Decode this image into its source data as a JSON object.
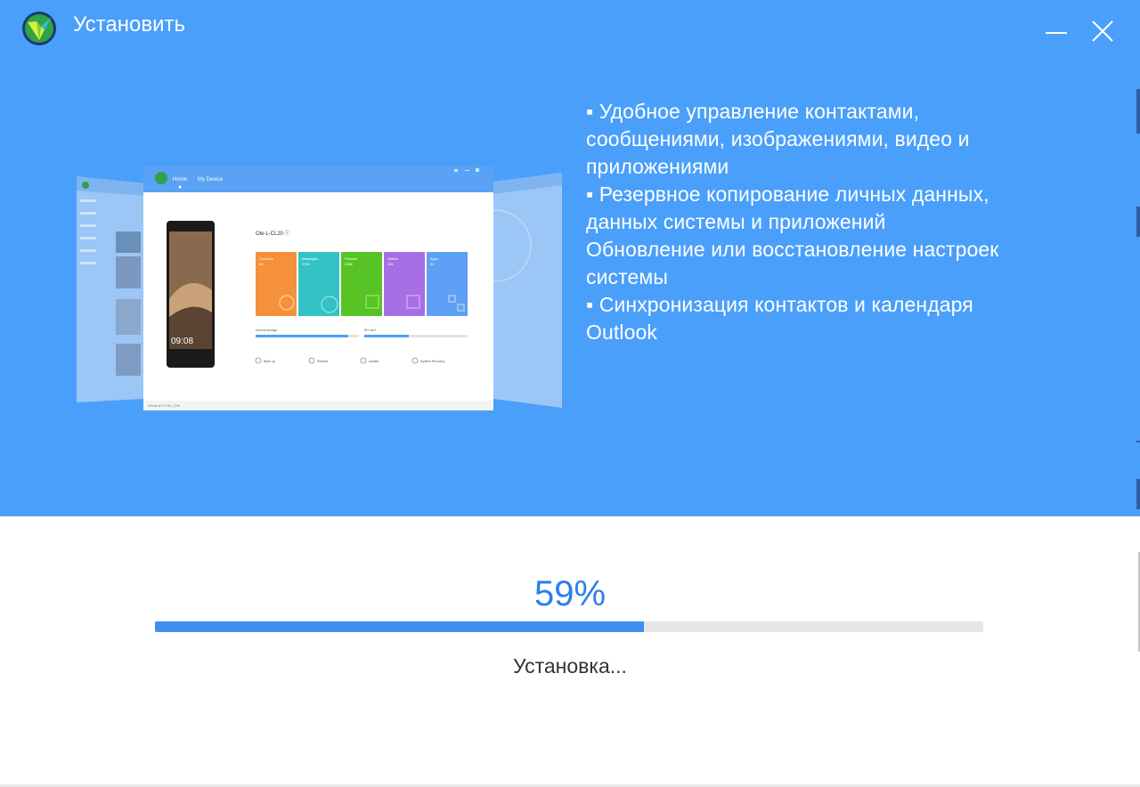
{
  "window": {
    "title": "Установить"
  },
  "icons": {
    "app_logo": "hisuite-logo-icon",
    "minimize": "minimize-icon",
    "close": "close-icon"
  },
  "colors": {
    "hero_background": "#4a9ffb",
    "accent": "#2a7fe8",
    "progress_fill": "#3f8ff2",
    "progress_track": "#e6e6e6"
  },
  "features": [
    "▪ Удобное управление контактами,",
    "сообщениями, изображениями, видео и",
    "приложениями",
    "▪ Резервное копирование личных данных,",
    "данных системы и приложений",
    "Обновление или восстановление настроек",
    "системы",
    "▪ Синхронизация контактов и календаря",
    "Outlook"
  ],
  "illustration": {
    "nav_home": "Home",
    "nav_device": "My Device",
    "device_name": "Ole-L-CL20 ⓘ",
    "phone_time": "09:08",
    "tiles": [
      {
        "label": "Contacts",
        "count": "69",
        "color": "#f5913b"
      },
      {
        "label": "Messages",
        "count": "2752",
        "color": "#33c3c4"
      },
      {
        "label": "Pictures",
        "count": "3166",
        "color": "#58c324"
      },
      {
        "label": "Videos",
        "count": "115",
        "color": "#a86ee6"
      },
      {
        "label": "Apps",
        "count": "42",
        "color": "#5da0f5"
      }
    ],
    "storage_internal": "Internal storage",
    "storage_sd": "SD card",
    "actions": [
      "Back up",
      "Restore",
      "Update",
      "System Recovery"
    ],
    "footer_version": "HiSuite 8.0.0.301_OVE"
  },
  "progress": {
    "percent_label": "59%",
    "value": 0.59,
    "status": "Установка..."
  }
}
